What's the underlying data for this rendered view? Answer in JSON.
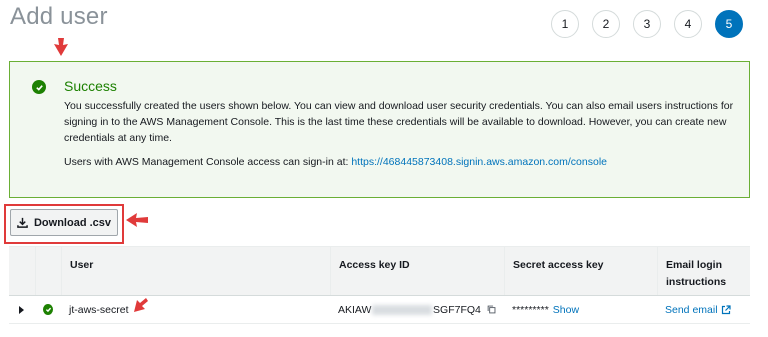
{
  "page": {
    "title": "Add user"
  },
  "steps": [
    "1",
    "2",
    "3",
    "4",
    "5"
  ],
  "active_step": "5",
  "colors": {
    "accent": "#0073bb",
    "success": "#1d8102",
    "annotation": "#e03a3a"
  },
  "alert": {
    "title": "Success",
    "body": "You successfully created the users shown below. You can view and download user security credentials. You can also email users instructions for signing in to the AWS Management Console. This is the last time these credentials will be available to download. However, you can create new credentials at any time.",
    "signin_prefix": "Users with AWS Management Console access can sign-in at: ",
    "signin_url": "https://468445873408.signin.aws.amazon.com/console"
  },
  "download_button": {
    "label": "Download .csv"
  },
  "table": {
    "headers": {
      "user": "User",
      "access_key": "Access key ID",
      "secret_key": "Secret access key",
      "email": "Email login instructions"
    },
    "rows": [
      {
        "user": "jt-aws-secret",
        "access_key_start": "AKIAW",
        "access_key_end": "SGF7FQ4",
        "secret_masked": "*********",
        "secret_action": "Show",
        "email_action": "Send email"
      }
    ]
  },
  "icons": [
    "success-check-icon",
    "download-icon",
    "expand-caret-icon",
    "copy-icon",
    "external-link-icon",
    "annotation-arrow-icon"
  ]
}
